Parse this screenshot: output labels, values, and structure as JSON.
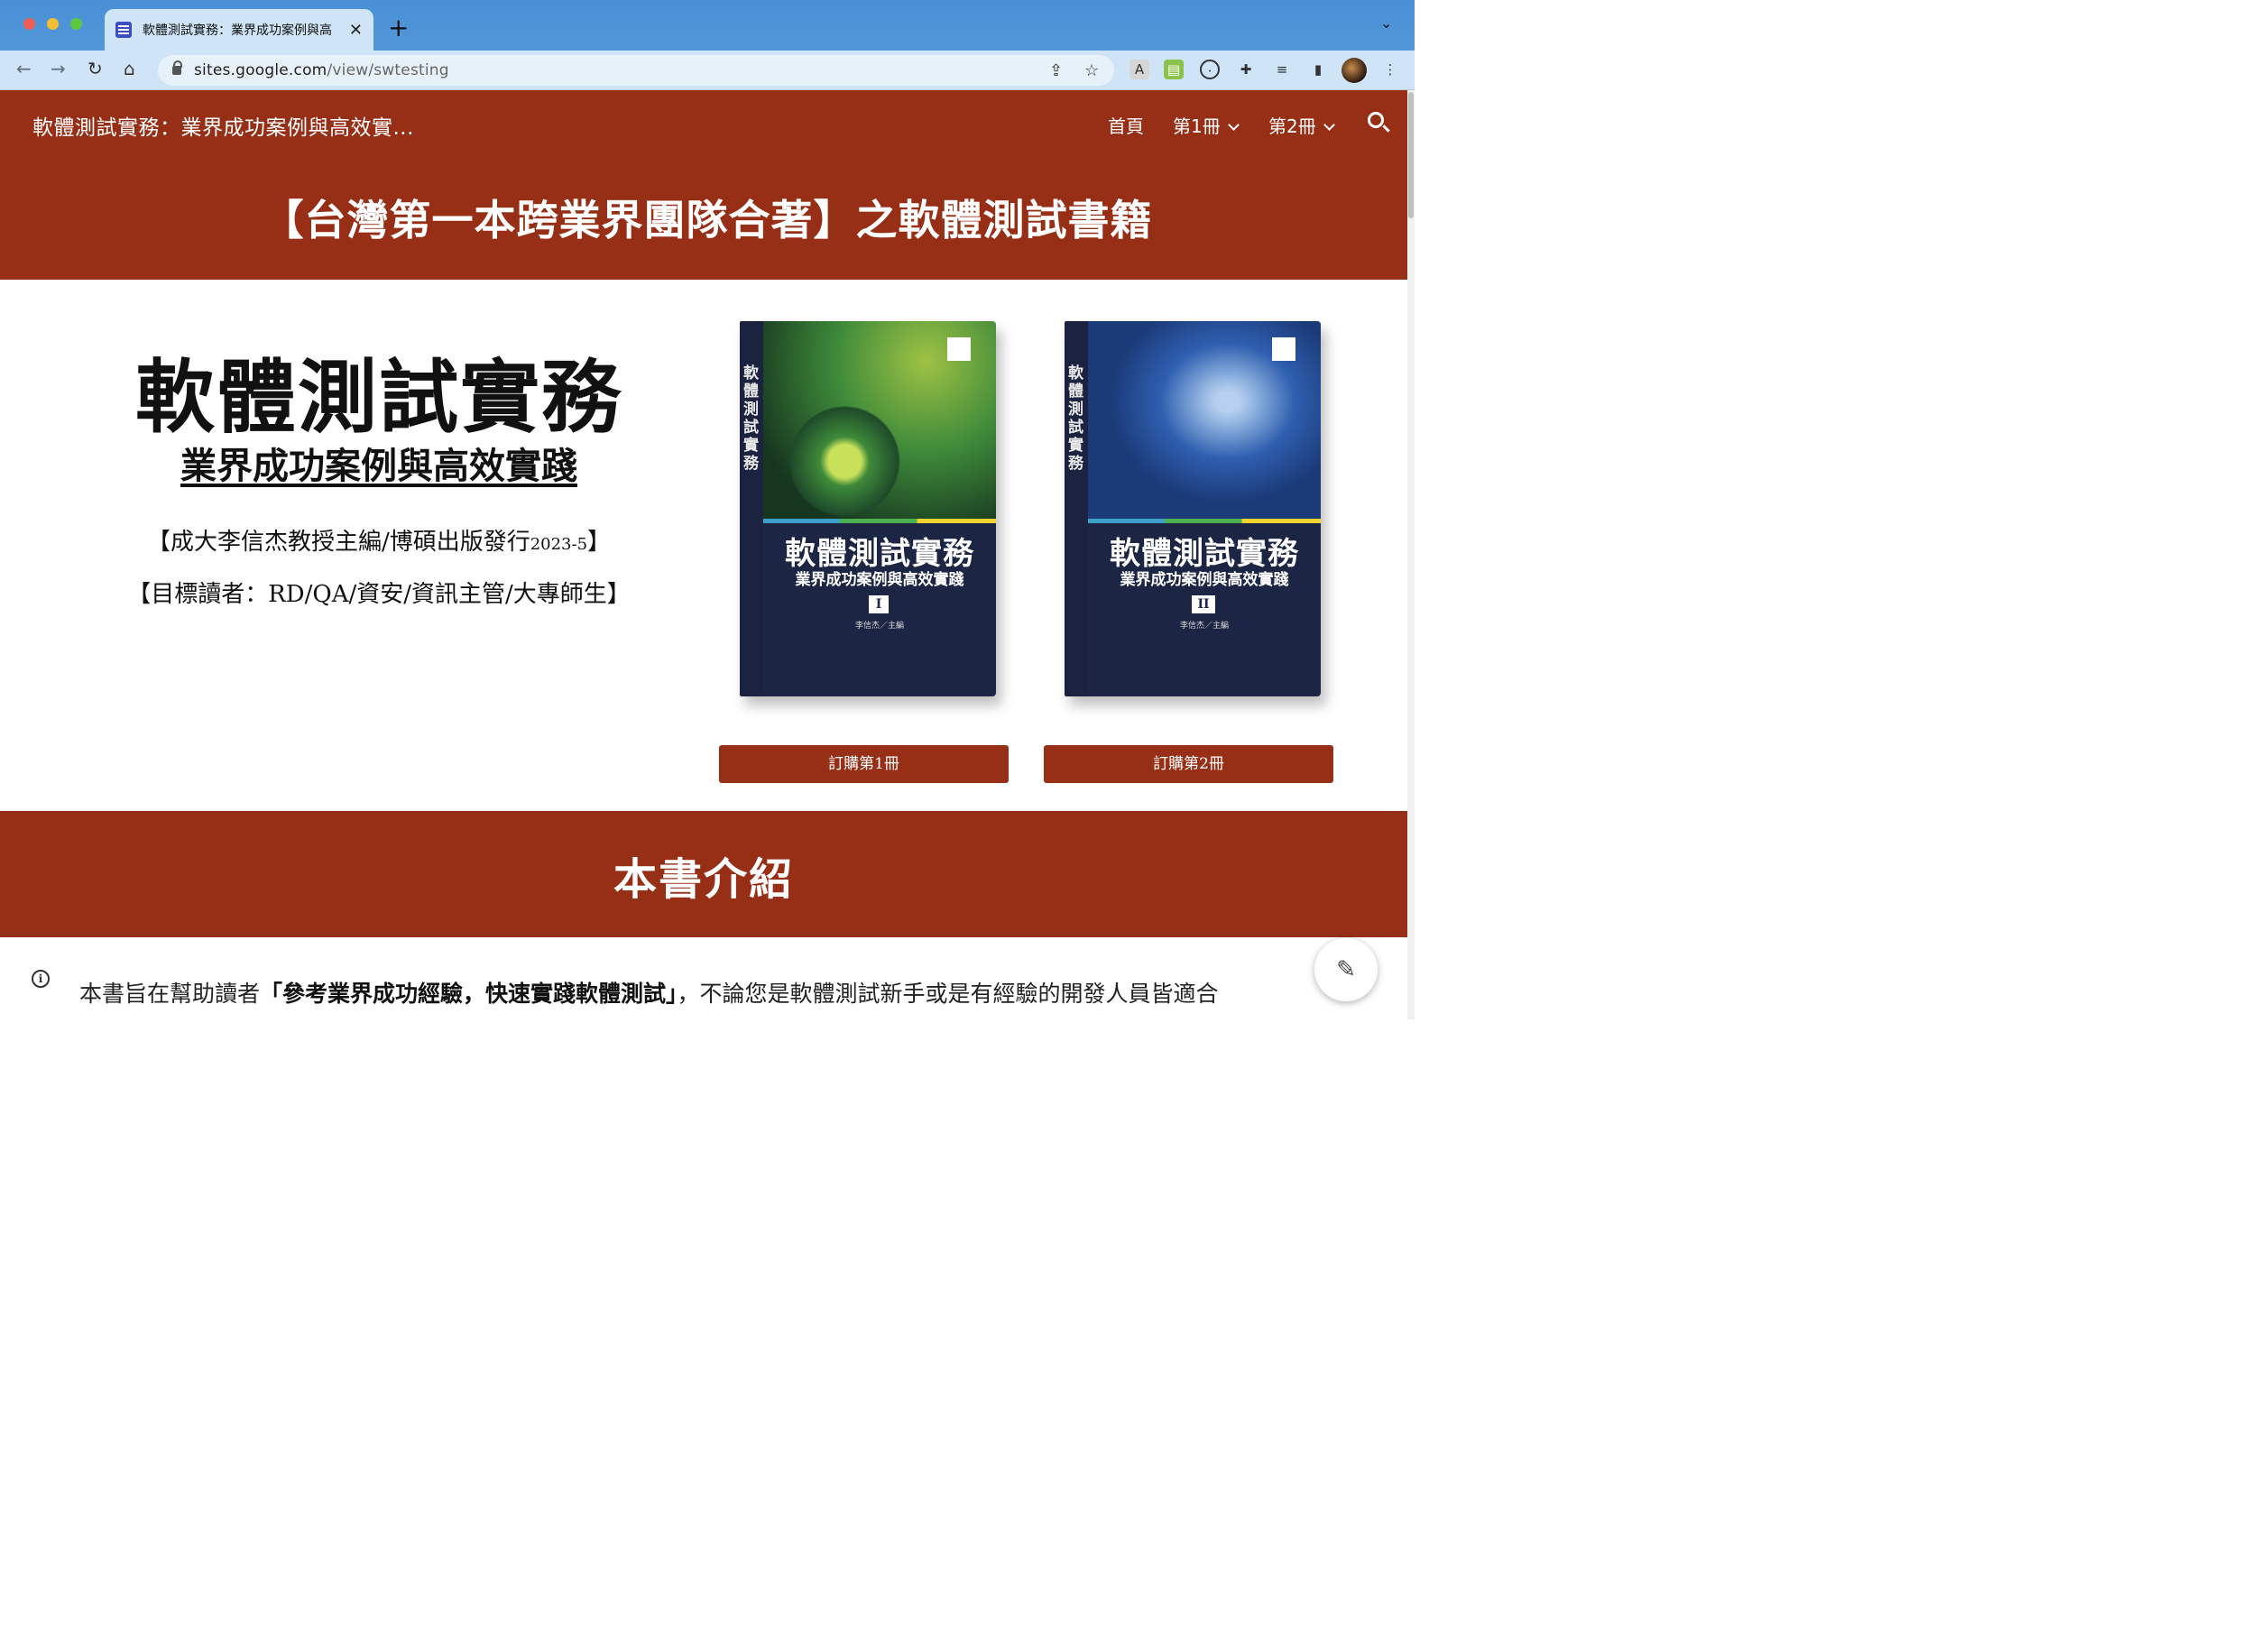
{
  "browser": {
    "tab_title": "軟體測試實務：業界成功案例與高",
    "tab_close": "✕",
    "new_tab": "+",
    "url_host": "sites.google.com",
    "url_path": "/view/swtesting"
  },
  "site": {
    "title": "軟體測試實務：業界成功案例與高效實...",
    "nav": [
      "首頁",
      "第1冊",
      "第2冊"
    ],
    "banner": "【台灣第一本跨業界團隊合著】之軟體測試書籍"
  },
  "hero": {
    "title": "軟體測試實務",
    "subtitle": "業界成功案例與高效實踐",
    "editor_line_prefix": "【成大李信杰教授主編/博碩出版發行",
    "editor_line_year": "2023-5",
    "editor_line_suffix": "】",
    "audience_line": "【目標讀者：RD/QA/資安/資訊主管/大專師生】"
  },
  "books": [
    {
      "spine": "軟體測試實務",
      "title": "軟體測試實務",
      "subtitle": "業界成功案例與高效實踐",
      "volume": "I",
      "editor": "李信杰／主編",
      "order_label": "訂購第1冊",
      "colors": {
        "art_a": "#1f4a2a",
        "art_b": "#9ec244",
        "art_c": "#3e8a3a"
      }
    },
    {
      "spine": "軟體測試實務",
      "title": "軟體測試實務",
      "subtitle": "業界成功案例與高效實踐",
      "volume": "II",
      "editor": "李信杰／主編",
      "order_label": "訂購第2冊",
      "colors": {
        "art_a": "#1b3a78",
        "art_b": "#8fb3e0",
        "art_c": "#2f5fb0"
      }
    }
  ],
  "section": {
    "heading": "本書介紹",
    "intro_prefix": "本書旨在幫助讀者",
    "intro_bold": "「參考業界成功經驗，快速實踐軟體測試」",
    "intro_suffix": "，不論您是軟體測試新手或是有經驗的開發人員皆適合"
  },
  "theme": {
    "brand": "#972f17",
    "chrome_tab": "#4f94d4",
    "chrome_bar": "#cfe4f7"
  }
}
